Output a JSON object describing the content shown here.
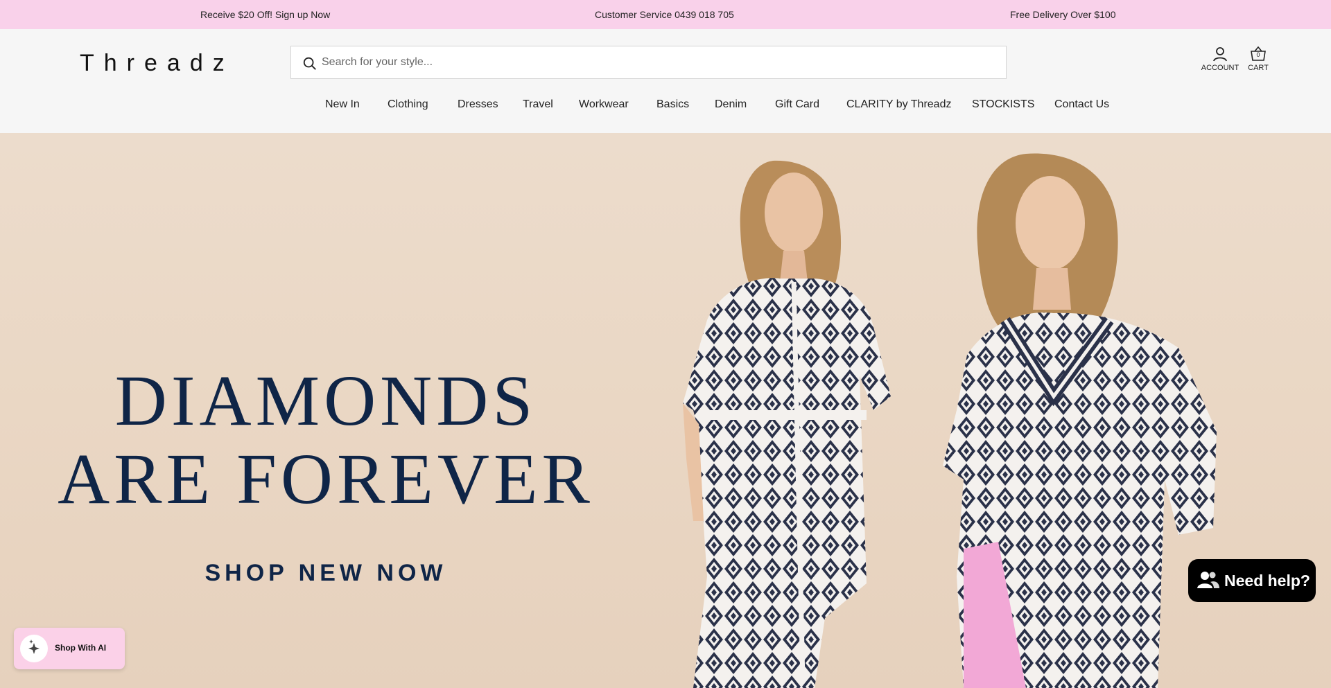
{
  "announcement": {
    "left": "Receive $20 Off! Sign up Now",
    "center": "Customer Service 0439 018 705",
    "right": "Free Delivery Over $100"
  },
  "header": {
    "logo": "Threadz",
    "search_placeholder": "Search for your style...",
    "account_label": "ACCOUNT",
    "cart_label": "CART",
    "cart_count": "0"
  },
  "nav": {
    "items": [
      "New In",
      "Clothing",
      "Dresses",
      "Travel",
      "Workwear",
      "Basics",
      "Denim",
      "Gift Card",
      "CLARITY by Threadz",
      "STOCKISTS",
      "Contact Us"
    ]
  },
  "hero": {
    "title_line1": "DIAMONDS",
    "title_line2": "ARE FOREVER",
    "cta": "SHOP NEW NOW",
    "title_color": "#0f2547",
    "background_color": "#ead7c4"
  },
  "widgets": {
    "shop_ai": "Shop With AI",
    "need_help": "Need help?"
  },
  "colors": {
    "announcement_bg": "#f9d1ea",
    "header_bg": "#f6f6f6"
  },
  "icons": {
    "search": "search-icon",
    "account": "user-icon",
    "cart": "basket-icon",
    "ai": "sparkle-icon",
    "help": "chat-icon"
  }
}
